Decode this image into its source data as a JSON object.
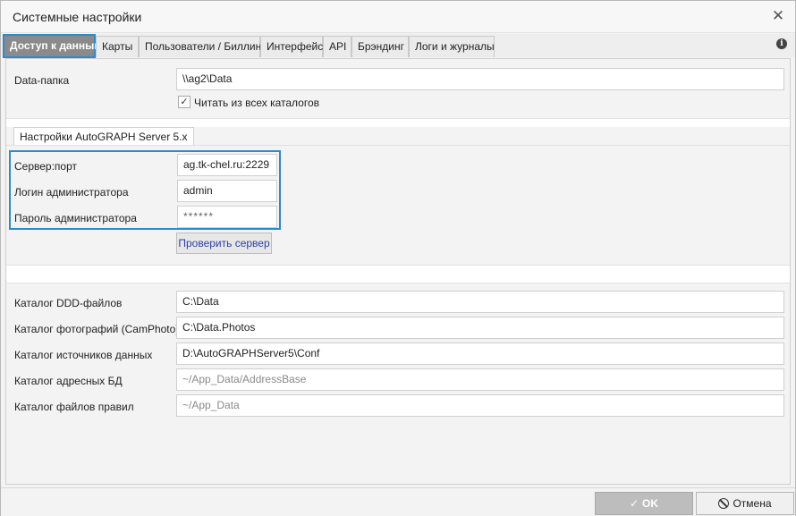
{
  "window": {
    "title": "Системные настройки"
  },
  "tabs": [
    {
      "label": "Доступ к данным",
      "active": true
    },
    {
      "label": "Карты"
    },
    {
      "label": "Пользователи / Биллинг"
    },
    {
      "label": "Интерфейс"
    },
    {
      "label": "API"
    },
    {
      "label": "Брэндинг"
    },
    {
      "label": "Логи и журналы"
    }
  ],
  "data_folder": {
    "label": "Data-папка",
    "value": "\\\\ag2\\Data",
    "read_all_checkbox": {
      "label": "Читать из всех каталогов",
      "checked": true
    }
  },
  "server_group": {
    "legend": "Настройки AutoGRAPH Server 5.x",
    "server_port": {
      "label": "Сервер:порт",
      "value": "ag.tk-chel.ru:2229"
    },
    "admin_login": {
      "label": "Логин администратора",
      "value": "admin"
    },
    "admin_password": {
      "label": "Пароль администратора",
      "value": "******"
    },
    "check_button": "Проверить сервер"
  },
  "catalogs": {
    "ddd": {
      "label": "Каталог DDD-файлов",
      "value": "C:\\Data"
    },
    "photos": {
      "label": "Каталог фотографий (CamPhoto)",
      "value": "C:\\Data.Photos"
    },
    "sources": {
      "label": "Каталог источников данных",
      "value": "D:\\AutoGRAPHServer5\\Conf"
    },
    "address": {
      "label": "Каталог адресных БД",
      "placeholder": "~/App_Data/AddressBase"
    },
    "rules": {
      "label": "Каталог файлов правил",
      "placeholder": "~/App_Data"
    }
  },
  "footer": {
    "ok_label": "OK",
    "cancel_label": "Отмена"
  },
  "icons": {
    "close": "close-icon",
    "info": "info-icon",
    "check": "checkmark-icon",
    "cancel": "cancel-circle-icon"
  },
  "colors": {
    "accent": "#2e8bc9",
    "active_tab_bg": "#8a8a8a",
    "link_text": "#2c3fa8"
  }
}
